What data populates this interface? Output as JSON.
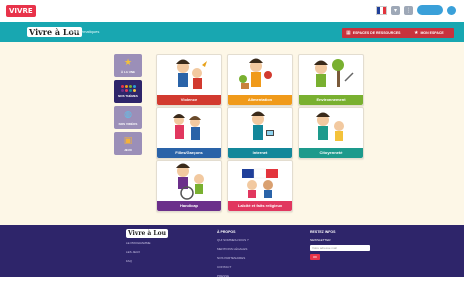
{
  "topbar": {
    "logo": "VIVRE",
    "flag_colors": [
      "#1f3f9a",
      "#ffffff",
      "#e3343d"
    ]
  },
  "header": {
    "brand": "Vivre à Lou",
    "subtitle": "Les thématiques",
    "buttons": [
      {
        "label": "ESPACES DE RESSOURCES",
        "icon": "grid-icon"
      },
      {
        "label": "MON ESPACE",
        "icon": "star-icon"
      }
    ],
    "colors": {
      "header": "#18a7b1",
      "button": "#c8323d"
    }
  },
  "side_menu": [
    {
      "label": "À LA UNE",
      "icon": "star-icon",
      "active": false
    },
    {
      "label": "NOS THÈMES",
      "icon": "dots-grid-icon",
      "active": true
    },
    {
      "label": "NOS VIDÉOS",
      "icon": "globe-icon",
      "active": false
    },
    {
      "label": "JEUX",
      "icon": "gift-icon",
      "active": false
    }
  ],
  "tiles": [
    {
      "label": "Violence",
      "color": "#d23a2f"
    },
    {
      "label": "Alimentation",
      "color": "#f09a1a"
    },
    {
      "label": "Environnement",
      "color": "#79b030"
    },
    {
      "label": "Filles/Garçons",
      "color": "#2a63a8"
    },
    {
      "label": "Internet",
      "color": "#13879a"
    },
    {
      "label": "Citoyenneté",
      "color": "#1d9a8c"
    },
    {
      "label": "Handicap",
      "color": "#6b2f8a"
    },
    {
      "label": "Laïcité et faits religieux",
      "color": "#e1375f"
    }
  ],
  "footer": {
    "brand": "Vivre à Lou",
    "col1": [
      "LE PROGRAMME",
      "LES JEUX",
      "FAQ"
    ],
    "col2_title": "À PROPOS",
    "col2": [
      "QUI SOMMES-NOUS ?",
      "MENTIONS LÉGALES",
      "NOS PARTENAIRES",
      "CONTACT",
      "PRESSE"
    ],
    "col3_title": "RESTEZ INFOS",
    "newsletter_label": "NEWSLETTER",
    "newsletter_placeholder": "Votre adresse mail",
    "ok": "OK"
  }
}
